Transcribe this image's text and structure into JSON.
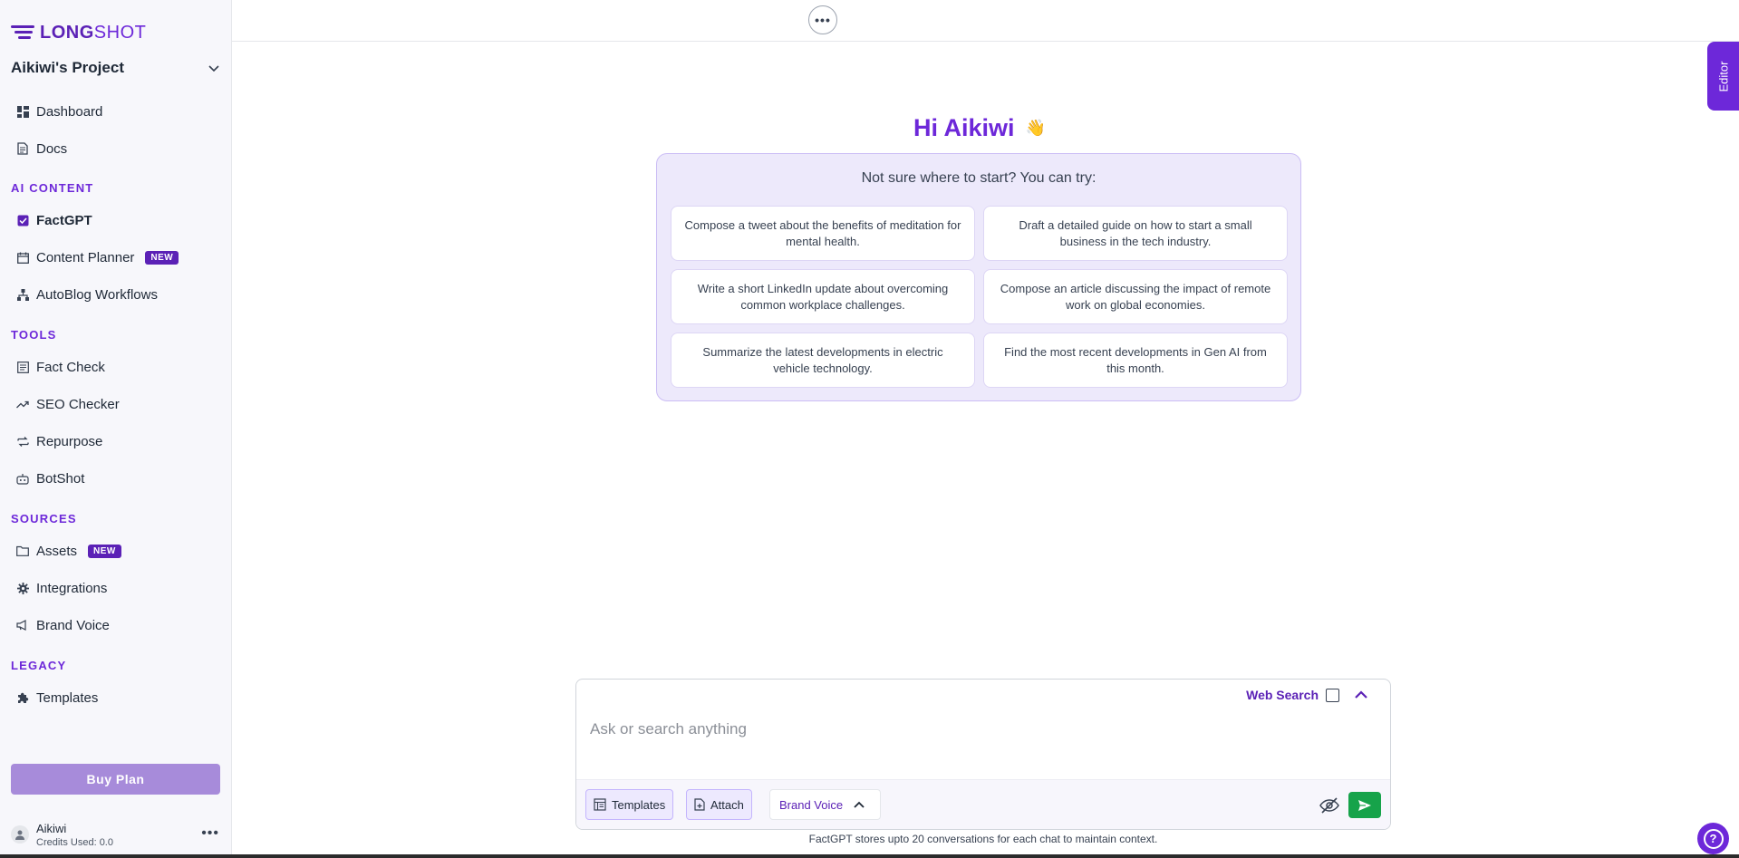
{
  "brand": {
    "name_bold": "LONG",
    "name_light": "SHOT"
  },
  "project": {
    "name": "Aikiwi's Project"
  },
  "sidebar": {
    "top_items": [
      {
        "label": "Dashboard",
        "icon": "dashboard-icon"
      },
      {
        "label": "Docs",
        "icon": "docs-icon"
      }
    ],
    "sections": {
      "ai_content": "AI CONTENT",
      "tools": "TOOLS",
      "sources": "SOURCES",
      "legacy": "LEGACY"
    },
    "ai_content_items": [
      {
        "label": "FactGPT",
        "icon": "factgpt-icon",
        "active": true
      },
      {
        "label": "Content Planner",
        "icon": "calendar-icon",
        "badge": "NEW"
      },
      {
        "label": "AutoBlog Workflows",
        "icon": "workflow-icon"
      }
    ],
    "tools_items": [
      {
        "label": "Fact Check",
        "icon": "fact-check-icon"
      },
      {
        "label": "SEO Checker",
        "icon": "trending-icon"
      },
      {
        "label": "Repurpose",
        "icon": "repurpose-icon"
      },
      {
        "label": "BotShot",
        "icon": "bot-icon"
      }
    ],
    "sources_items": [
      {
        "label": "Assets",
        "icon": "folder-icon",
        "badge": "NEW"
      },
      {
        "label": "Integrations",
        "icon": "gear-icon"
      },
      {
        "label": "Brand Voice",
        "icon": "megaphone-icon"
      }
    ],
    "legacy_items": [
      {
        "label": "Templates",
        "icon": "puzzle-icon"
      }
    ],
    "buy_plan": "Buy Plan",
    "user": {
      "name": "Aikiwi",
      "credits": "Credits Used: 0.0"
    }
  },
  "main": {
    "editor_tab": "Editor",
    "greeting": "Hi Aikiwi",
    "greeting_emoji": "👋",
    "suggestions_title": "Not sure where to start? You can try:",
    "suggestions": [
      "Compose a tweet about the benefits of meditation for mental health.",
      "Draft a detailed guide on how to start a small business in the tech industry.",
      "Write a short LinkedIn update about overcoming common workplace challenges.",
      "Compose an article discussing the impact of remote work on global economies.",
      "Summarize the latest developments in electric vehicle technology.",
      "Find the most recent developments in Gen AI from this month."
    ],
    "composer": {
      "web_search_label": "Web Search",
      "web_search_checked": false,
      "placeholder": "Ask or search anything",
      "value": "",
      "templates_label": "Templates",
      "attach_label": "Attach",
      "brand_voice_label": "Brand Voice"
    },
    "footnote": "FactGPT stores upto 20 conversations for each chat to maintain context."
  },
  "colors": {
    "accent": "#6d28d9",
    "accent_dark": "#5b21b6",
    "buy_plan": "#a78bda",
    "send": "#16a34a",
    "suggest_bg": "#ede9fb"
  }
}
